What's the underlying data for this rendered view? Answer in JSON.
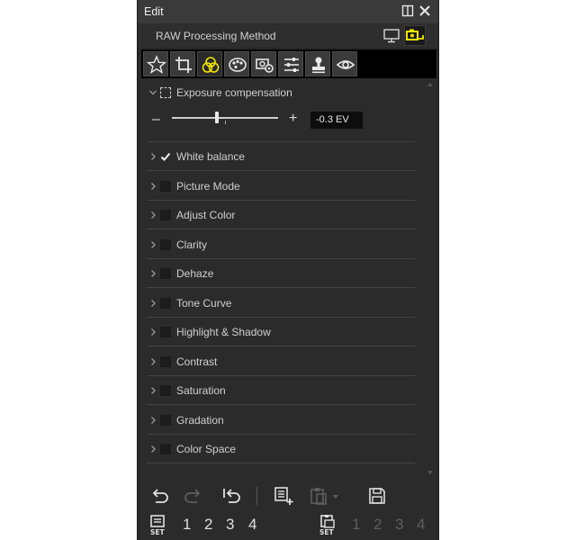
{
  "window": {
    "title": "Edit"
  },
  "header": {
    "label": "RAW Processing Method"
  },
  "tools": [
    {
      "icon": "star-icon"
    },
    {
      "icon": "crop-icon"
    },
    {
      "icon": "color-circles-icon",
      "active": true
    },
    {
      "icon": "palette-icon"
    },
    {
      "icon": "camera-settings-icon"
    },
    {
      "icon": "sliders-icon"
    },
    {
      "icon": "stamp-icon"
    },
    {
      "icon": "eye-icon"
    }
  ],
  "exposure": {
    "label": "Exposure compensation",
    "minus": "–",
    "plus": "+",
    "value": "-0.3 EV",
    "slider_fraction": 0.42
  },
  "sections": [
    {
      "label": "White balance",
      "checked": true
    },
    {
      "label": "Picture Mode",
      "checked": false
    },
    {
      "label": "Adjust Color",
      "checked": false
    },
    {
      "label": "Clarity",
      "checked": false
    },
    {
      "label": "Dehaze",
      "checked": false
    },
    {
      "label": "Tone Curve",
      "checked": false
    },
    {
      "label": "Highlight & Shadow",
      "checked": false
    },
    {
      "label": "Contrast",
      "checked": false
    },
    {
      "label": "Saturation",
      "checked": false
    },
    {
      "label": "Gradation",
      "checked": false
    },
    {
      "label": "Color Space",
      "checked": false
    }
  ],
  "presets_left": [
    "1",
    "2",
    "3",
    "4"
  ],
  "presets_right": [
    "1",
    "2",
    "3",
    "4"
  ],
  "colors": {
    "accent": "#f2e600",
    "panel_bg": "#2b2b2b"
  }
}
